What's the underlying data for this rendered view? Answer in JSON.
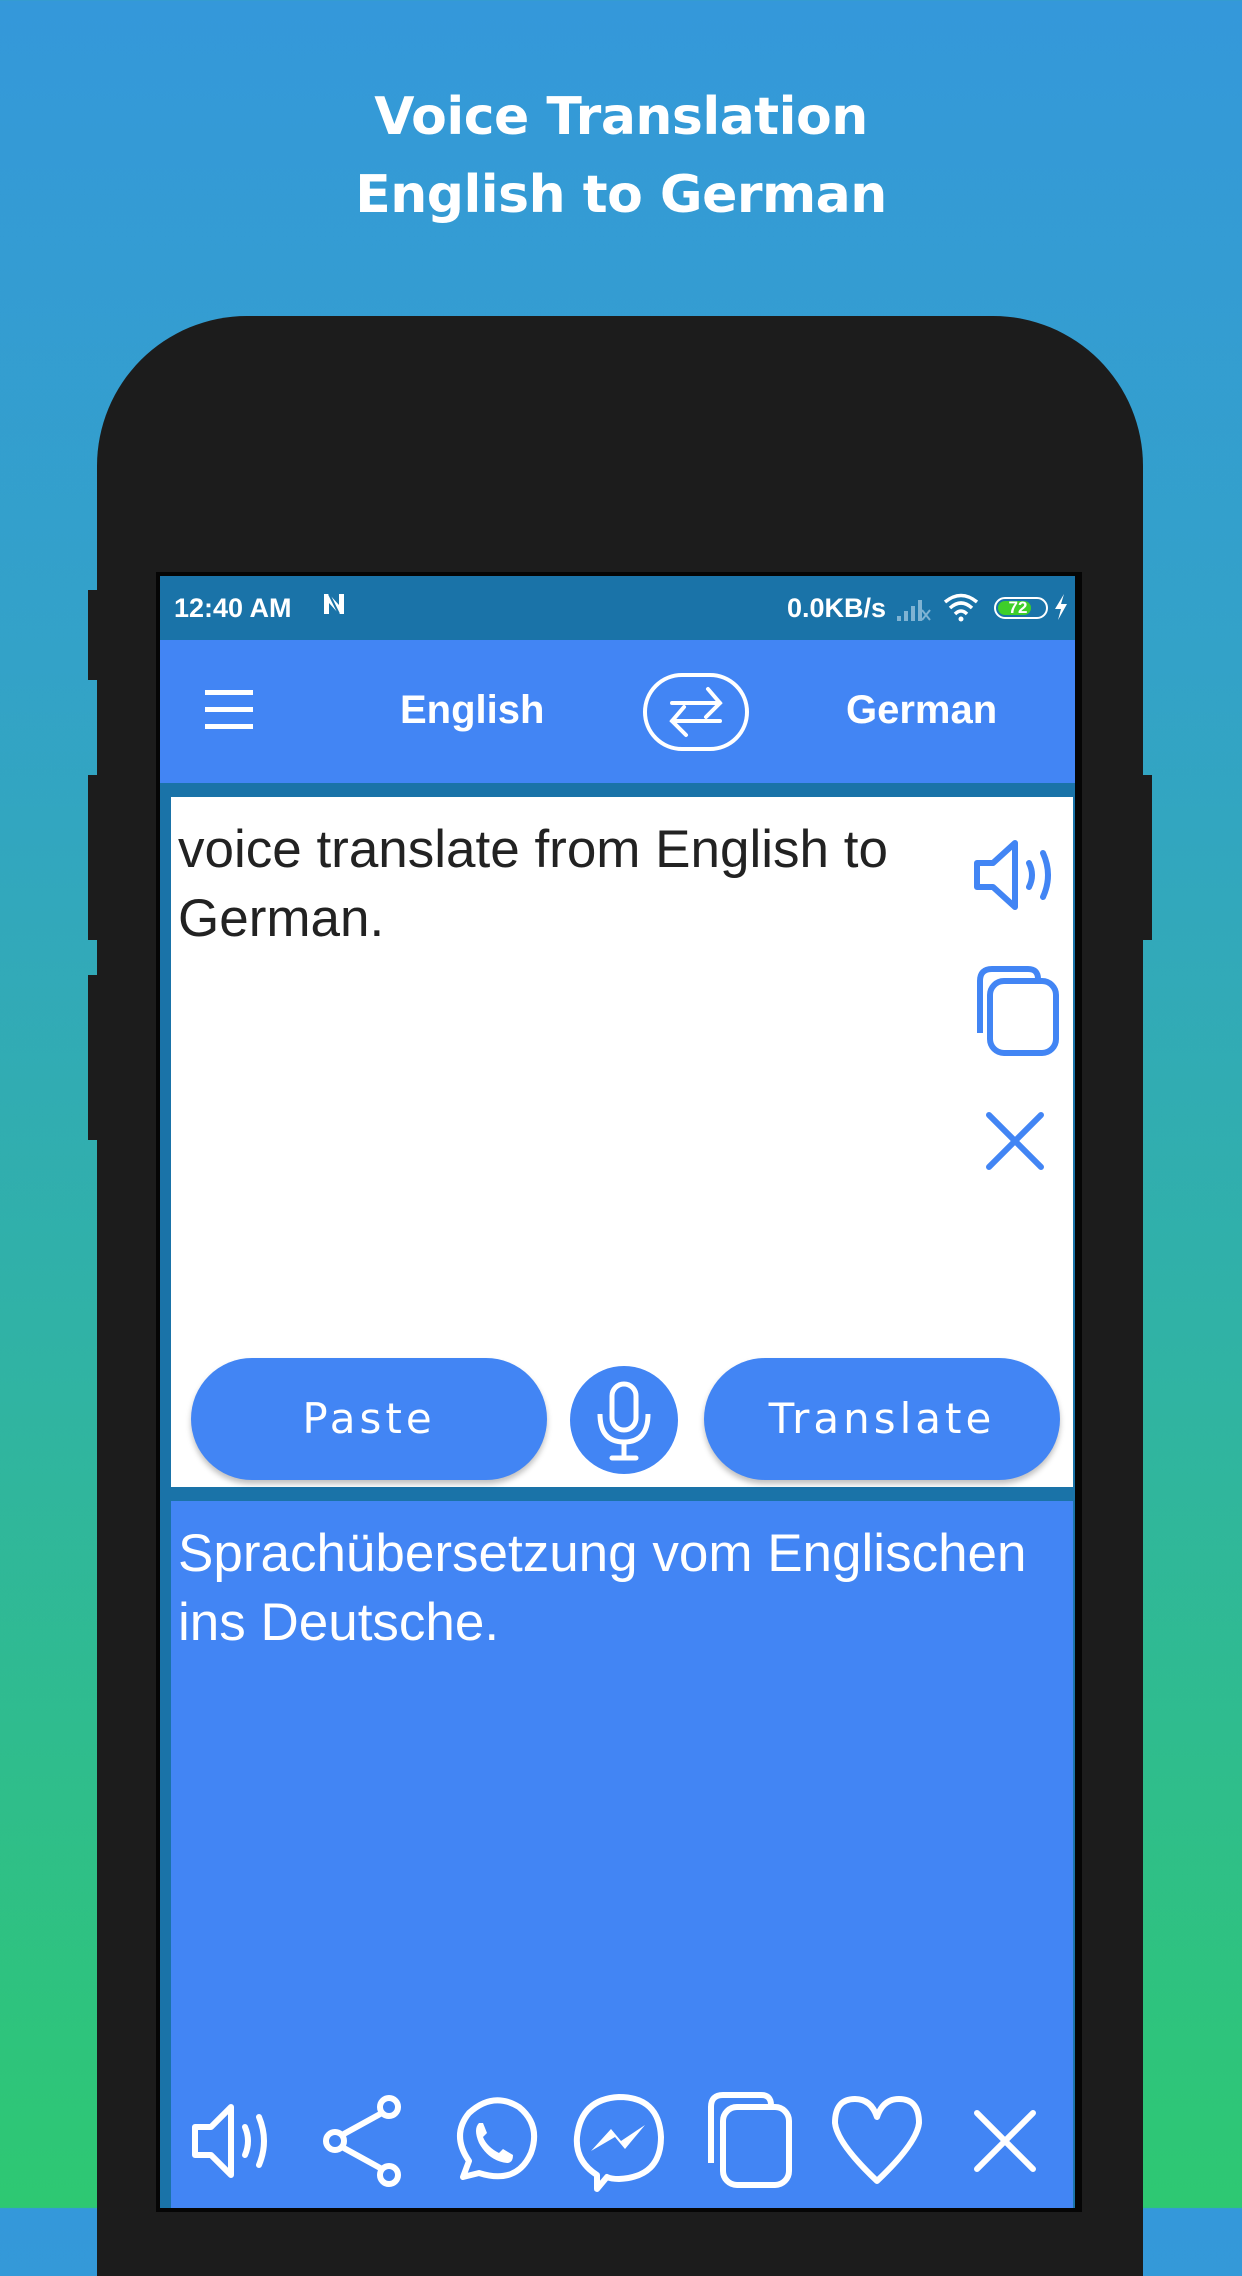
{
  "promo": {
    "title_line1": "Voice Translation",
    "title_line2": "English to German"
  },
  "status_bar": {
    "time": "12:40 AM",
    "notification_icon": "n-icon",
    "network_speed": "0.0KB/s",
    "signal_icon": "signal-icon",
    "wifi_icon": "wifi-icon",
    "battery_level": "72",
    "battery_percent": 72,
    "charging_icon": "charging-bolt-icon"
  },
  "header": {
    "menu_icon": "hamburger-menu-icon",
    "source_language": "English",
    "swap_icon": "swap-arrows-icon",
    "target_language": "German"
  },
  "input": {
    "text": "voice translate from English to German.",
    "side_actions": [
      {
        "icon": "speaker-icon",
        "label": "Speak"
      },
      {
        "icon": "copy-icon",
        "label": "Copy"
      },
      {
        "icon": "close-icon",
        "label": "Clear"
      }
    ],
    "paste_label": "Paste",
    "mic_icon": "microphone-icon",
    "translate_label": "Translate"
  },
  "output": {
    "text": "Sprachübersetzung vom Englischen ins Deutsche.",
    "actions": [
      {
        "icon": "speaker-icon",
        "label": "Speak"
      },
      {
        "icon": "share-icon",
        "label": "Share"
      },
      {
        "icon": "whatsapp-icon",
        "label": "WhatsApp"
      },
      {
        "icon": "messenger-icon",
        "label": "Messenger"
      },
      {
        "icon": "copy-icon",
        "label": "Copy"
      },
      {
        "icon": "heart-icon",
        "label": "Favorite"
      },
      {
        "icon": "close-icon",
        "label": "Clear"
      }
    ]
  },
  "colors": {
    "primary": "#4285f4",
    "status_bar": "#1a73a8",
    "phone_body": "#1c1c1c",
    "background_top": "#3498da",
    "background_bottom": "#2ec872",
    "battery_fill": "#3ecf2a"
  }
}
